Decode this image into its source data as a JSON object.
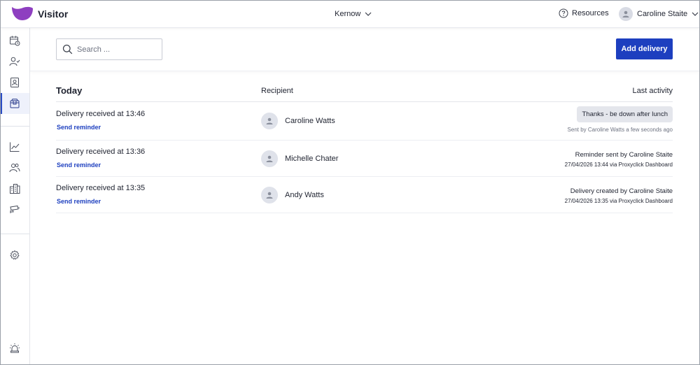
{
  "app": {
    "brand": "Visitor",
    "brand_color": "#8e3fc0",
    "location": "Kernow",
    "resources_label": "Resources",
    "user_name": "Caroline Staite"
  },
  "sidebar": {
    "items": [
      {
        "icon": "calendar-icon",
        "active": false
      },
      {
        "icon": "user-check-icon",
        "active": false
      },
      {
        "icon": "badge-icon",
        "active": false
      },
      {
        "icon": "package-icon",
        "active": true
      },
      {
        "icon": "chart-line-icon",
        "active": false
      },
      {
        "icon": "users-icon",
        "active": false
      },
      {
        "icon": "buildings-icon",
        "active": false
      },
      {
        "icon": "camera-icon",
        "active": false
      },
      {
        "icon": "gear-icon",
        "active": false
      },
      {
        "icon": "alarm-icon",
        "active": false
      }
    ]
  },
  "toolbar": {
    "search_placeholder": "Search ...",
    "add_button_label": "Add delivery",
    "accent_color": "#1d3fbf"
  },
  "table": {
    "group_title": "Today",
    "col_recipient": "Recipient",
    "col_activity": "Last activity",
    "rows": [
      {
        "title": "Delivery received at 13:46",
        "link": "Send reminder",
        "recipient": "Caroline Watts",
        "activity_bubble": "Thanks - be down after lunch",
        "activity_meta": "Sent by Caroline Watts a few seconds ago"
      },
      {
        "title": "Delivery received at 13:36",
        "link": "Send reminder",
        "recipient": "Michelle Chater",
        "activity_main": "Reminder sent by Caroline Staite",
        "activity_sub": "27/04/2026 13:44 via Proxyclick Dashboard"
      },
      {
        "title": "Delivery received at 13:35",
        "link": "Send reminder",
        "recipient": "Andy Watts",
        "activity_main": "Delivery created by Caroline Staite",
        "activity_sub": "27/04/2026 13:35 via Proxyclick Dashboard"
      }
    ]
  }
}
